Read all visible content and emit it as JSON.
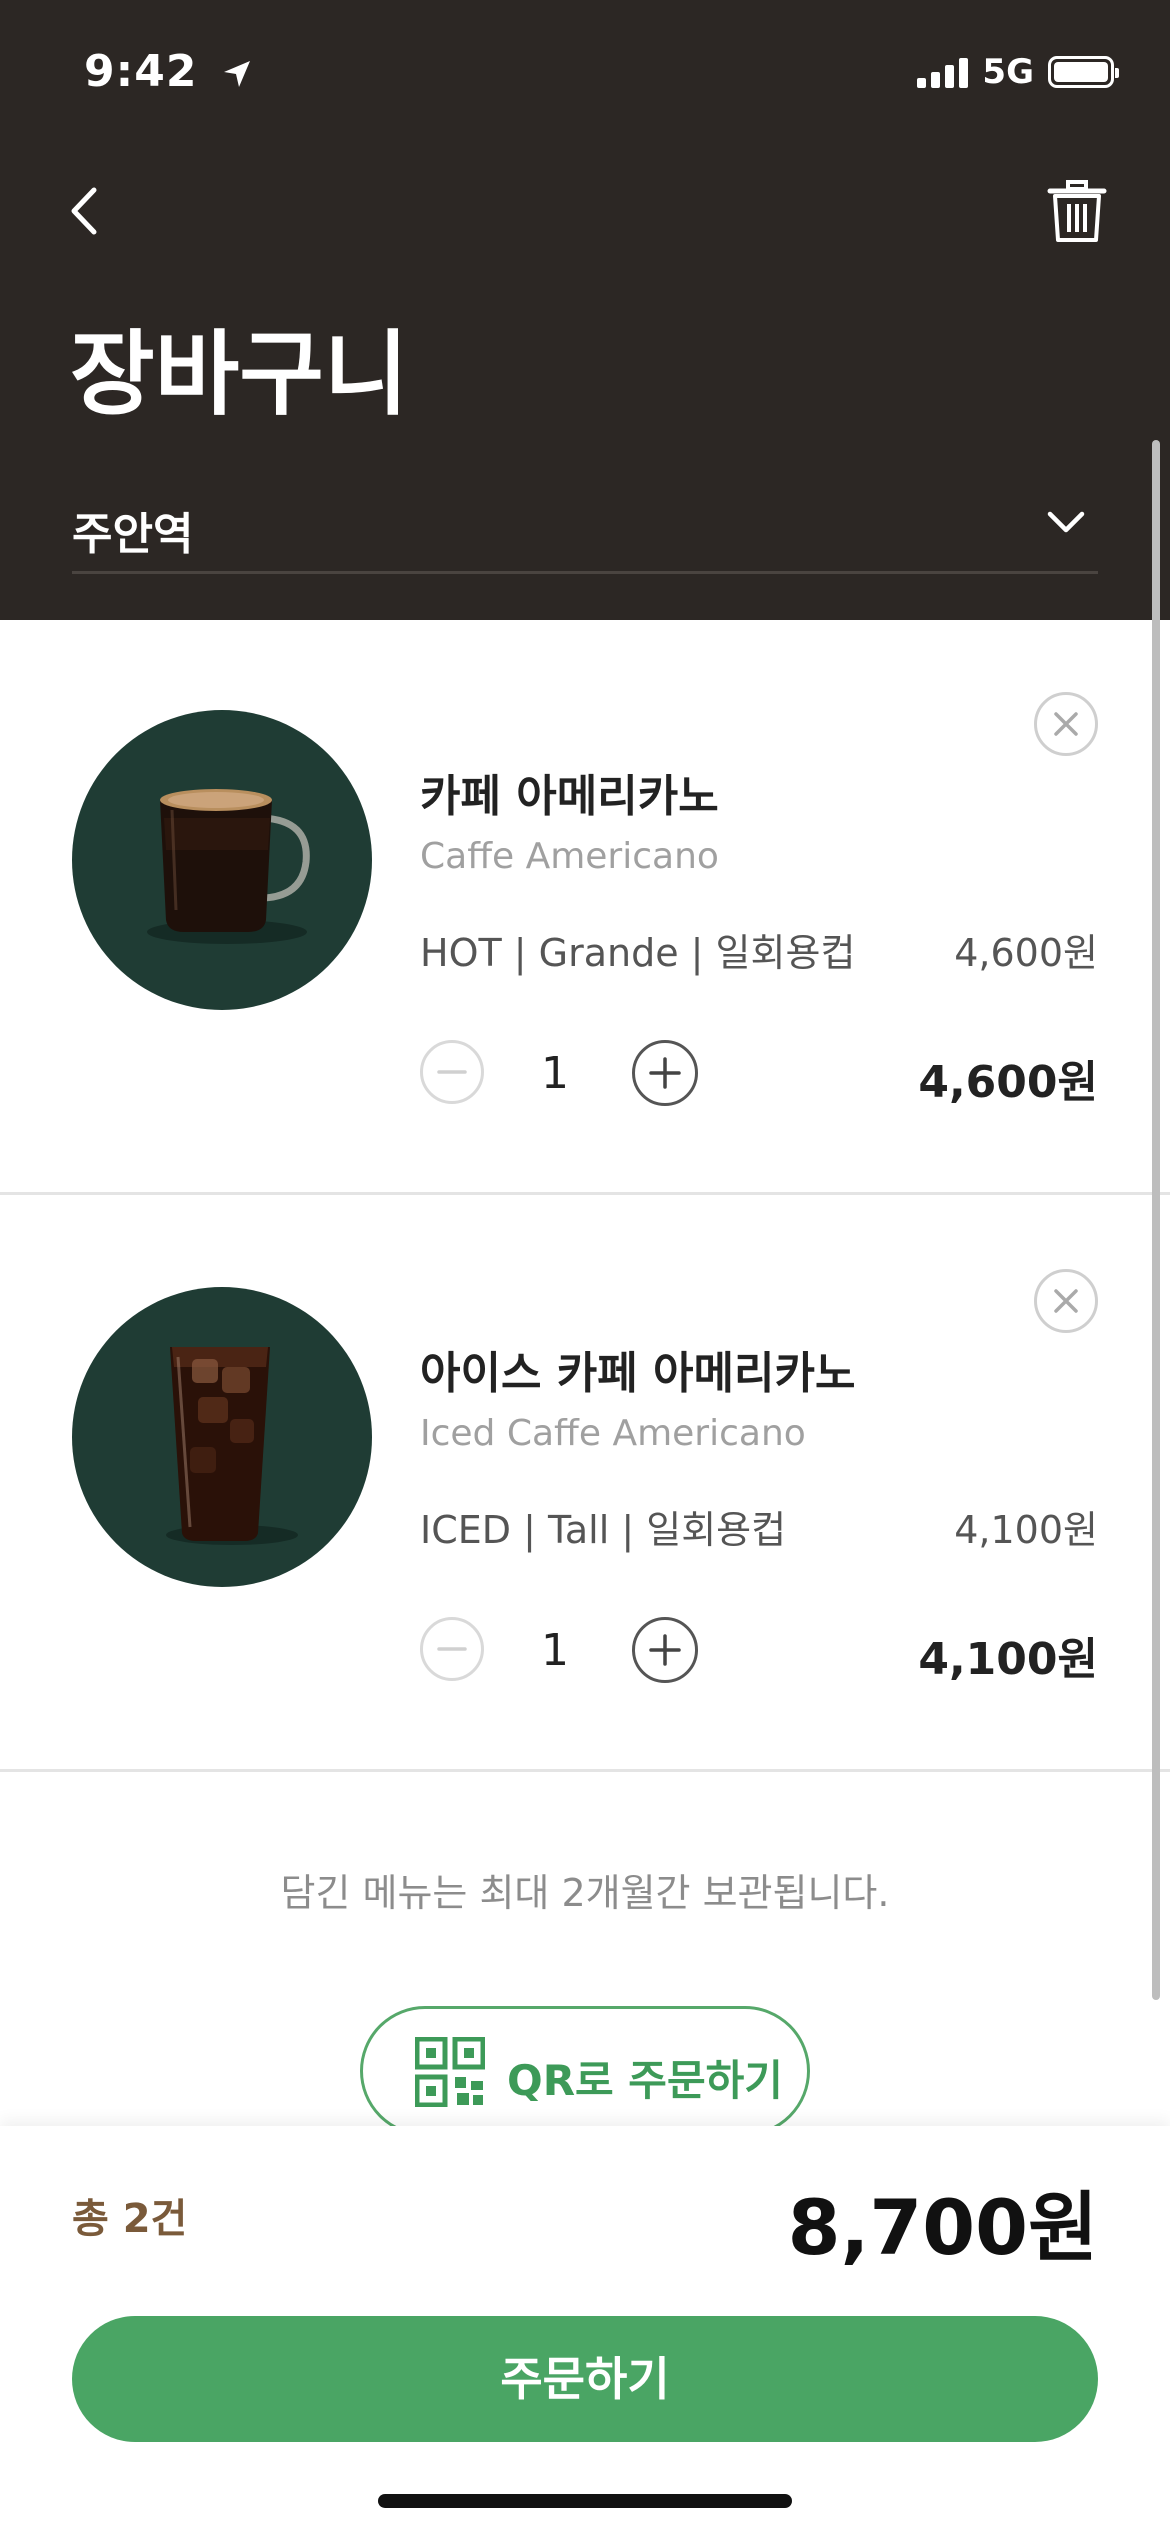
{
  "status_bar": {
    "time": "9:42",
    "network": "5G"
  },
  "header": {
    "title": "장바구니",
    "store": "주안역"
  },
  "items": [
    {
      "name_ko": "카페 아메리카노",
      "name_en": "Caffe Americano",
      "options": "HOT | Grande | 일회용컵",
      "unit_price": "4,600원",
      "quantity": "1",
      "line_total": "4,600원"
    },
    {
      "name_ko": "아이스 카페 아메리카노",
      "name_en": "Iced Caffe Americano",
      "options": "ICED | Tall | 일회용컵",
      "unit_price": "4,100원",
      "quantity": "1",
      "line_total": "4,100원"
    }
  ],
  "note": "담긴 메뉴는 최대 2개월간 보관됩니다.",
  "qr_button": "QR로 주문하기",
  "summary": {
    "count": "총 2건",
    "total": "8,700원"
  },
  "order_button": "주문하기",
  "colors": {
    "header_bg": "#2c2724",
    "accent_green": "#4aa564",
    "thumb_bg": "#1f3c34"
  }
}
